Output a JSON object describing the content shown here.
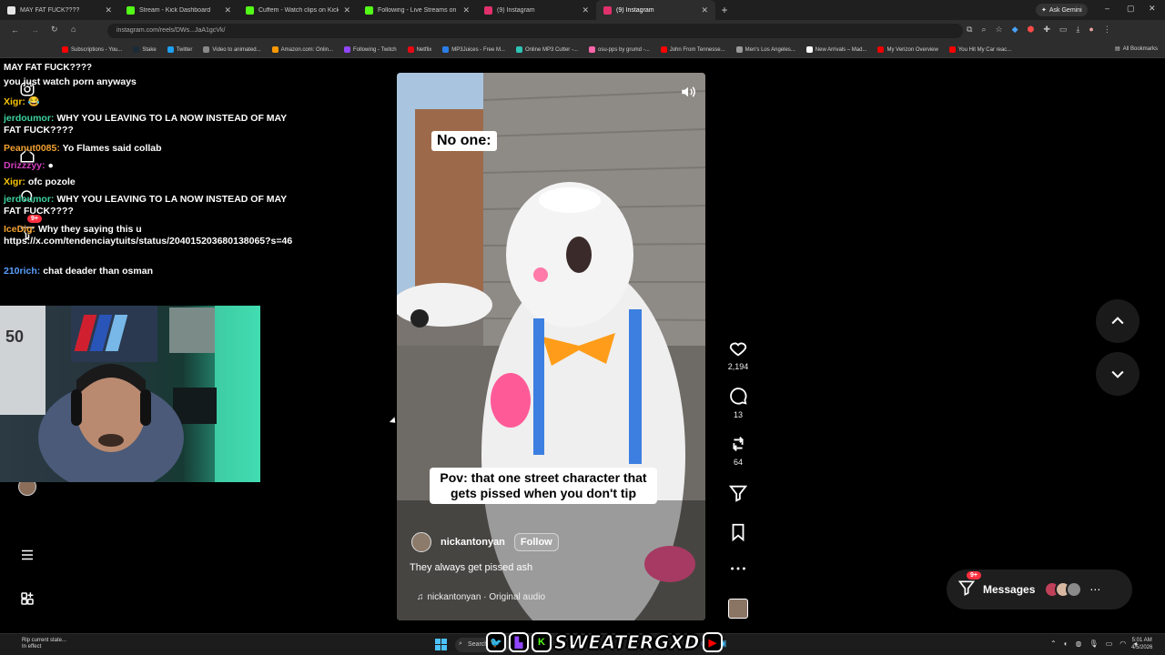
{
  "browser": {
    "tabs": [
      {
        "label": "MAY FAT FUCK????",
        "color": "#e6e6e6",
        "active": false
      },
      {
        "label": "Stream - Kick Dashboard",
        "color": "#53fc18",
        "active": false
      },
      {
        "label": "Cuffem - Watch clips on Kick",
        "color": "#53fc18",
        "active": false
      },
      {
        "label": "Following - Live Streams on Kick",
        "color": "#53fc18",
        "active": false
      },
      {
        "label": "(9) Instagram",
        "color": "#e1306c",
        "active": false
      },
      {
        "label": "(9) Instagram",
        "color": "#e1306c",
        "active": true
      }
    ],
    "new_tab": "+",
    "ask_gemini": "Ask Gemini",
    "url": "instagram.com/reels/DWs...JaA1gcVk/",
    "bookmarks": [
      {
        "label": "Subscriptions - You...",
        "color": "#ff0000"
      },
      {
        "label": "Stake",
        "color": "#1a2c38"
      },
      {
        "label": "Twitter",
        "color": "#1da1f2"
      },
      {
        "label": "Video to animated...",
        "color": "#888888"
      },
      {
        "label": "Amazon.com: Onlin...",
        "color": "#ff9900"
      },
      {
        "label": "Following - Twitch",
        "color": "#9146ff"
      },
      {
        "label": "Netflix",
        "color": "#e50914"
      },
      {
        "label": "MP3Juices - Free M...",
        "color": "#2b7de9"
      },
      {
        "label": "Online MP3 Cutter -...",
        "color": "#2ec4b6"
      },
      {
        "label": "osu-pps by grumd -...",
        "color": "#ff66aa"
      },
      {
        "label": "John From Tennesse...",
        "color": "#ff0000"
      },
      {
        "label": "Men's Los Angeles...",
        "color": "#999999"
      },
      {
        "label": "New Arrivals – Mad...",
        "color": "#ffffff"
      },
      {
        "label": "My Verizon Overview",
        "color": "#ee0000"
      },
      {
        "label": "You Hit My Car reac...",
        "color": "#ff0000"
      }
    ],
    "all_bookmarks": "All Bookmarks"
  },
  "chat": {
    "lines": [
      {
        "user": "",
        "text": "MAY FAT FUCK????",
        "color": "#ffffff"
      },
      {
        "user": "",
        "text": "you just watch porn anyways",
        "color": "#ffffff"
      },
      {
        "user": "Xigr:",
        "text": "😂",
        "color": "#f7c400"
      },
      {
        "user": "jerdoumor:",
        "text": "WHY YOU LEAVING TO LA NOW INSTEAD OF MAY FAT FUCK????",
        "color": "#3ed3a0"
      },
      {
        "user": "Peanut0085:",
        "text": "Yo Flames said collab",
        "color": "#f0a030"
      },
      {
        "user": "Drizzzyy:",
        "text": "●",
        "color": "#d33fbf"
      },
      {
        "user": "Xigr:",
        "text": "ofc pozole",
        "color": "#f7c400"
      },
      {
        "user": "jerdoumor:",
        "text": "WHY YOU LEAVING TO LA NOW INSTEAD OF MAY FAT FUCK????",
        "color": "#3ed3a0"
      },
      {
        "user": "IceDig:",
        "text": "Why they saying this u https://x.com/tendenciaytuits/status/204015203680138065?s=46",
        "color": "#f0a030"
      },
      {
        "user": "210rich:",
        "text": "chat deader than osman",
        "color": "#5aa0ff"
      }
    ]
  },
  "instagram": {
    "notifications_badge": "9+",
    "reel": {
      "top_caption": "No one:",
      "mid_caption": "Pov: that one street character that gets pissed when you don't tip",
      "username": "nickantonyan",
      "follow": "Follow",
      "description": "They always get pissed ash",
      "audio": "nickantonyan · Original audio"
    },
    "actions": {
      "likes": "2,194",
      "comments": "13",
      "reposts": "64"
    },
    "messages": {
      "label": "Messages",
      "badge": "9+"
    }
  },
  "taskbar": {
    "toast_line1": "Rip current state...",
    "toast_line2": "In effect",
    "search": "Search",
    "brand": "SWEATERGXD",
    "time": "5:01 AM",
    "date": "4/5/2026"
  },
  "colors": {
    "accent_red": "#ff3040",
    "kick_green": "#53fc18",
    "taskbar_blue": "#4cc2ff"
  }
}
